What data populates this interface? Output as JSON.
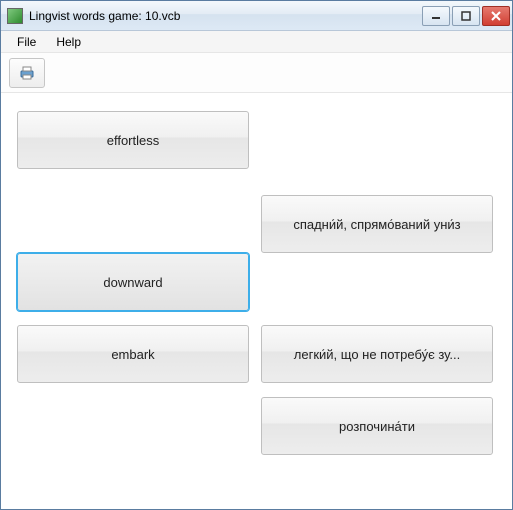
{
  "window": {
    "title": "Lingvist words game: 10.vcb"
  },
  "menu": {
    "file": "File",
    "help": "Help"
  },
  "icons": {
    "app": "app-icon",
    "print": "print-icon",
    "minimize": "minimize-icon",
    "maximize": "maximize-icon",
    "close": "close-icon"
  },
  "cards": {
    "left": [
      {
        "label": "effortless",
        "selected": false
      },
      {
        "label": "downward",
        "selected": true
      },
      {
        "label": "embark",
        "selected": false
      }
    ],
    "right": [
      {
        "label": "спадни́й, спрямо́ваний уни́з"
      },
      {
        "label": "легки́й, що не потребу́є зу..."
      },
      {
        "label": "розпочина́ти"
      }
    ]
  }
}
